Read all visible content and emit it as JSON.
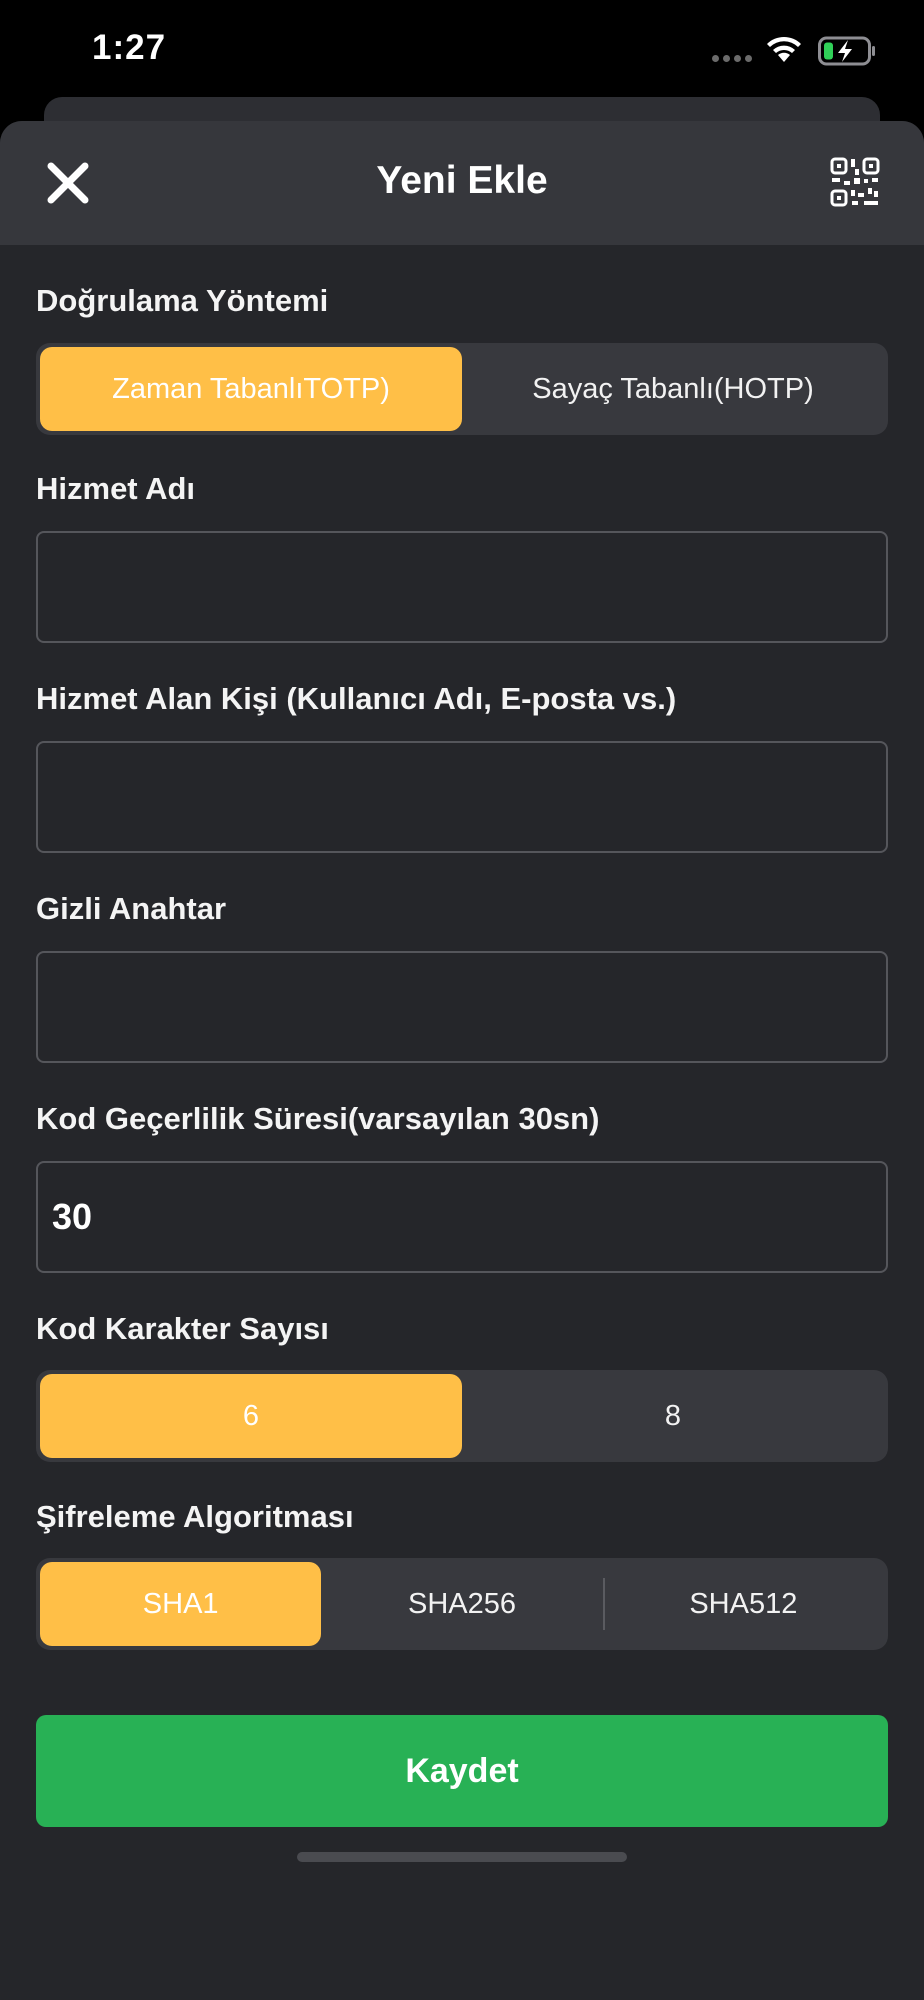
{
  "status": {
    "time": "1:27"
  },
  "nav": {
    "title": "Yeni Ekle",
    "close_icon": "close-icon",
    "qr_icon": "qr-code-icon"
  },
  "auth_method": {
    "label": "Doğrulama Yöntemi",
    "options": [
      "Zaman TabanlıTOTP)",
      "Sayaç Tabanlı(HOTP)"
    ],
    "selected": "Zaman TabanlıTOTP)"
  },
  "service_name": {
    "label": "Hizmet Adı",
    "value": ""
  },
  "account": {
    "label": "Hizmet Alan Kişi (Kullanıcı Adı, E-posta vs.)",
    "value": ""
  },
  "secret_key": {
    "label": "Gizli Anahtar",
    "value": ""
  },
  "period": {
    "label": "Kod Geçerlilik Süresi(varsayılan 30sn)",
    "value": "30"
  },
  "digits": {
    "label": "Kod Karakter Sayısı",
    "options": [
      "6",
      "8"
    ],
    "selected": "6"
  },
  "algorithm": {
    "label": "Şifreleme Algoritması",
    "options": [
      "SHA1",
      "SHA256",
      "SHA512"
    ],
    "selected": "SHA1"
  },
  "save_label": "Kaydet",
  "colors": {
    "accent": "#ffbf47",
    "save": "#28b155",
    "background": "#25262a",
    "nav": "#36373c"
  }
}
